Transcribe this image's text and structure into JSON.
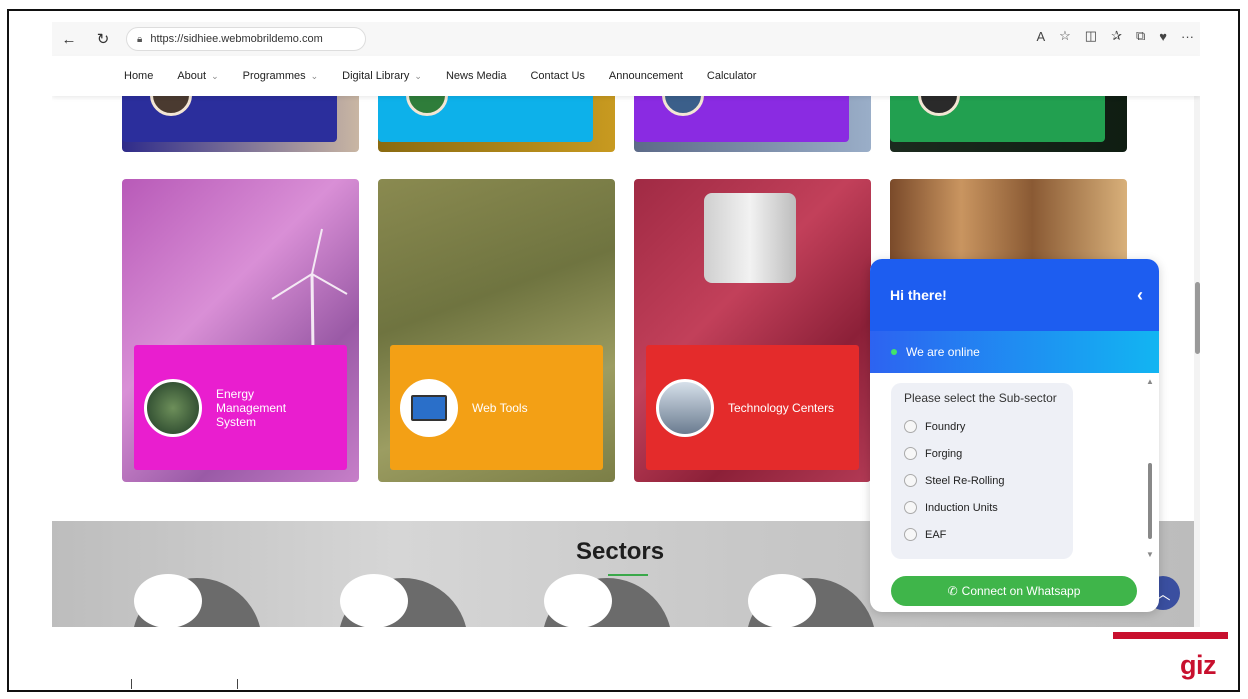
{
  "browser": {
    "url": "https://sidhiee.webmobrildemo.com",
    "toolbar_icons": [
      "read-aloud-icon",
      "favorite-icon",
      "split-screen-icon",
      "favorites-icon",
      "collections-icon",
      "extension-icon",
      "more-icon"
    ]
  },
  "nav": {
    "items": [
      {
        "label": "Home",
        "dropdown": false
      },
      {
        "label": "About",
        "dropdown": true
      },
      {
        "label": "Programmes",
        "dropdown": true
      },
      {
        "label": "Digital Library",
        "dropdown": true
      },
      {
        "label": "News Media",
        "dropdown": false
      },
      {
        "label": "Contact Us",
        "dropdown": false
      },
      {
        "label": "Announcement",
        "dropdown": false
      },
      {
        "label": "Calculator",
        "dropdown": false
      }
    ]
  },
  "tiles": [
    {
      "label_line1": "Energy",
      "label_line2": "Management",
      "label_line3": "System",
      "color": "#e91ecf"
    },
    {
      "label": "Web Tools",
      "color": "#f3a015"
    },
    {
      "label": "Technology Centers",
      "color": "#e42b2b"
    }
  ],
  "sectors": {
    "title": "Sectors"
  },
  "chat": {
    "greeting": "Hi there!",
    "status": "We are online",
    "prompt": "Please select the Sub-sector",
    "options": [
      "Foundry",
      "Forging",
      "Steel Re-Rolling",
      "Induction Units",
      "EAF"
    ],
    "whatsapp_label": "Connect on Whatsapp"
  },
  "logo": {
    "text": "giz",
    "color": "#c8102e"
  }
}
